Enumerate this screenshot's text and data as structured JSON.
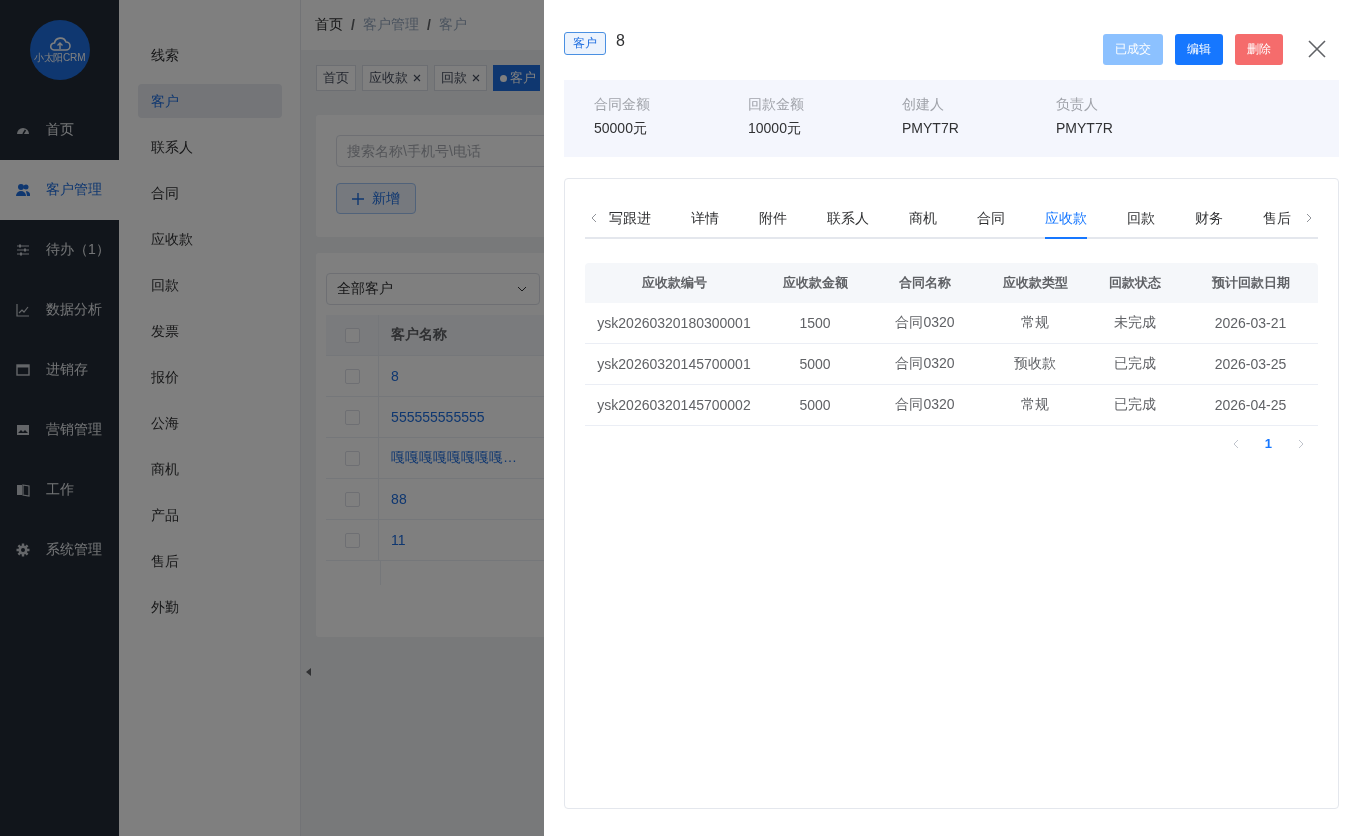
{
  "logo": {
    "text": "小太阳CRM"
  },
  "nav": [
    {
      "label": "首页",
      "selected": false
    },
    {
      "label": "客户管理",
      "selected": true
    },
    {
      "label": "待办（1）",
      "selected": false
    },
    {
      "label": "数据分析",
      "selected": false
    },
    {
      "label": "进销存",
      "selected": false
    },
    {
      "label": "营销管理",
      "selected": false
    },
    {
      "label": "工作",
      "selected": false
    },
    {
      "label": "系统管理",
      "selected": false
    }
  ],
  "subnav": [
    {
      "label": "线索",
      "selected": false
    },
    {
      "label": "客户",
      "selected": true
    },
    {
      "label": "联系人",
      "selected": false
    },
    {
      "label": "合同",
      "selected": false
    },
    {
      "label": "应收款",
      "selected": false
    },
    {
      "label": "回款",
      "selected": false
    },
    {
      "label": "发票",
      "selected": false
    },
    {
      "label": "报价",
      "selected": false
    },
    {
      "label": "公海",
      "selected": false
    },
    {
      "label": "商机",
      "selected": false
    },
    {
      "label": "产品",
      "selected": false
    },
    {
      "label": "售后",
      "selected": false
    },
    {
      "label": "外勤",
      "selected": false
    }
  ],
  "breadcrumb": [
    "首页",
    "客户管理",
    "客户"
  ],
  "breadcrumb_separators": [
    "/",
    "/"
  ],
  "page_tabs": [
    {
      "label": "首页",
      "closable": false,
      "selected": false
    },
    {
      "label": "应收款",
      "closable": true,
      "selected": false
    },
    {
      "label": "回款",
      "closable": true,
      "selected": false
    },
    {
      "label": "客户",
      "closable": false,
      "selected": true
    }
  ],
  "search": {
    "placeholder": "搜索名称\\手机号\\电话"
  },
  "add_button": {
    "label": "新增"
  },
  "filter_select": {
    "value": "全部客户"
  },
  "customer_table": {
    "all_checked": false,
    "columns": [
      "客户名称"
    ],
    "rows": [
      {
        "name": "8",
        "checked": false
      },
      {
        "name": "555555555555",
        "checked": false
      },
      {
        "name": "嘎嘎嘎嘎嘎嘎嘎嘎…",
        "checked": false
      },
      {
        "name": "88",
        "checked": false
      },
      {
        "name": "11",
        "checked": false
      }
    ]
  },
  "drawer": {
    "tag": "客户",
    "title": "8",
    "buttons": [
      {
        "label": "已成交",
        "kind": "primary",
        "disabled": true
      },
      {
        "label": "编辑",
        "kind": "primary",
        "disabled": false
      },
      {
        "label": "删除",
        "kind": "danger",
        "disabled": false
      }
    ],
    "summary": [
      {
        "label": "合同金额",
        "value": "50000元"
      },
      {
        "label": "回款金额",
        "value": "10000元"
      },
      {
        "label": "创建人",
        "value": "PMYT7R"
      },
      {
        "label": "负责人",
        "value": "PMYT7R"
      }
    ],
    "tabs": [
      {
        "label": "写跟进",
        "selected": false
      },
      {
        "label": "详情",
        "selected": false
      },
      {
        "label": "附件",
        "selected": false
      },
      {
        "label": "联系人",
        "selected": false
      },
      {
        "label": "商机",
        "selected": false
      },
      {
        "label": "合同",
        "selected": false
      },
      {
        "label": "应收款",
        "selected": true
      },
      {
        "label": "回款",
        "selected": false
      },
      {
        "label": "财务",
        "selected": false
      },
      {
        "label": "售后",
        "selected": false
      }
    ],
    "table": {
      "columns": [
        "应收款编号",
        "应收款金额",
        "合同名称",
        "应收款类型",
        "回款状态",
        "预计回款日期"
      ],
      "rows": [
        [
          "ysk20260320180300001",
          "1500",
          "合同0320",
          "常规",
          "未完成",
          "2026-03-21"
        ],
        [
          "ysk20260320145700001",
          "5000",
          "合同0320",
          "预收款",
          "已完成",
          "2026-03-25"
        ],
        [
          "ysk20260320145700002",
          "5000",
          "合同0320",
          "常规",
          "已完成",
          "2026-04-25"
        ]
      ]
    },
    "pagination": {
      "pages": [
        {
          "label": "1",
          "selected": true
        }
      ]
    }
  }
}
